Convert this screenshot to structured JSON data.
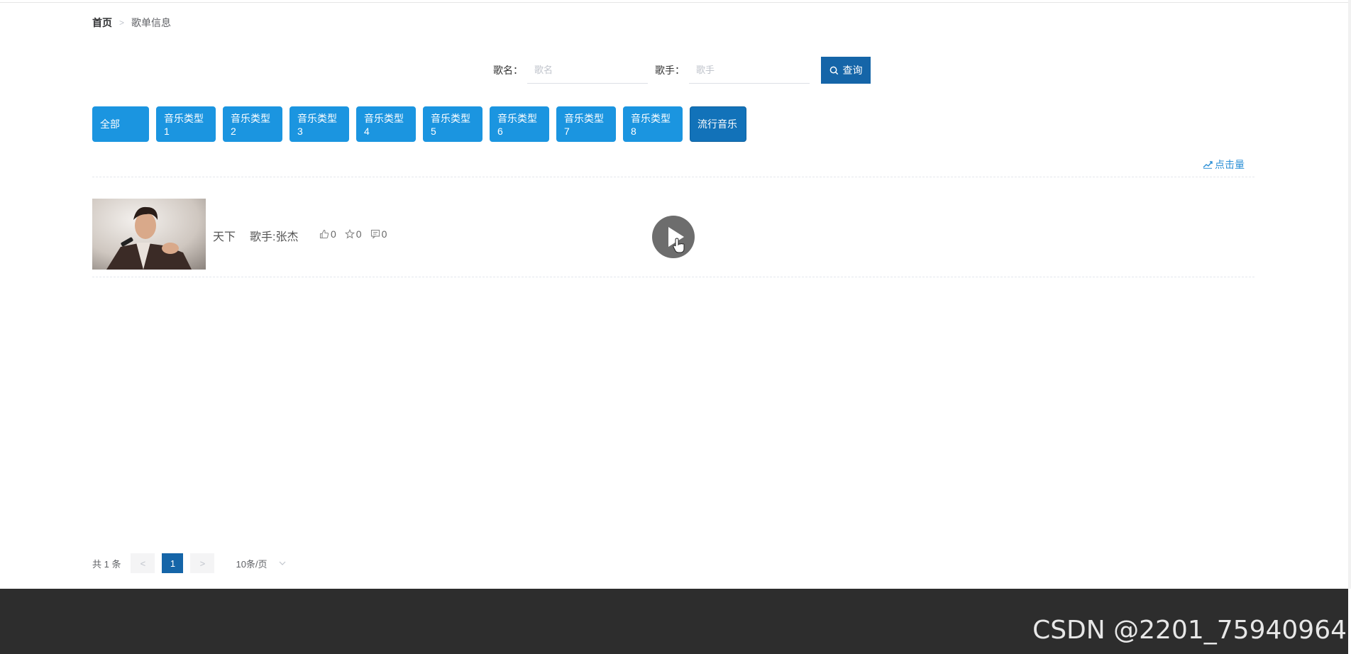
{
  "breadcrumb": {
    "home": "首页",
    "separator": ">",
    "current": "歌单信息"
  },
  "search": {
    "song_label": "歌名：",
    "song_placeholder": "歌名",
    "song_value": "",
    "singer_label": "歌手：",
    "singer_placeholder": "歌手",
    "singer_value": "",
    "button_label": "查询"
  },
  "categories": [
    {
      "label": "全部",
      "active": false
    },
    {
      "label": "音乐类型1",
      "active": false
    },
    {
      "label": "音乐类型2",
      "active": false
    },
    {
      "label": "音乐类型3",
      "active": false
    },
    {
      "label": "音乐类型4",
      "active": false
    },
    {
      "label": "音乐类型5",
      "active": false
    },
    {
      "label": "音乐类型6",
      "active": false
    },
    {
      "label": "音乐类型7",
      "active": false
    },
    {
      "label": "音乐类型8",
      "active": false
    },
    {
      "label": "流行音乐",
      "active": true
    }
  ],
  "sort": {
    "label": "点击量",
    "icon": "trend-chart-icon"
  },
  "songs": [
    {
      "title": "天下",
      "singer": "歌手:张杰",
      "likes": "0",
      "favorites": "0",
      "comments": "0"
    }
  ],
  "pagination": {
    "total": "共 1 条",
    "prev": "<",
    "current_page": "1",
    "next": ">",
    "page_size": "10条/页"
  },
  "watermark": "CSDN @2201_75940964",
  "colors": {
    "primary": "#1b95e0",
    "primary_dark": "#1565a8",
    "footer": "#2d2d2d",
    "link": "#2b8fd6"
  }
}
